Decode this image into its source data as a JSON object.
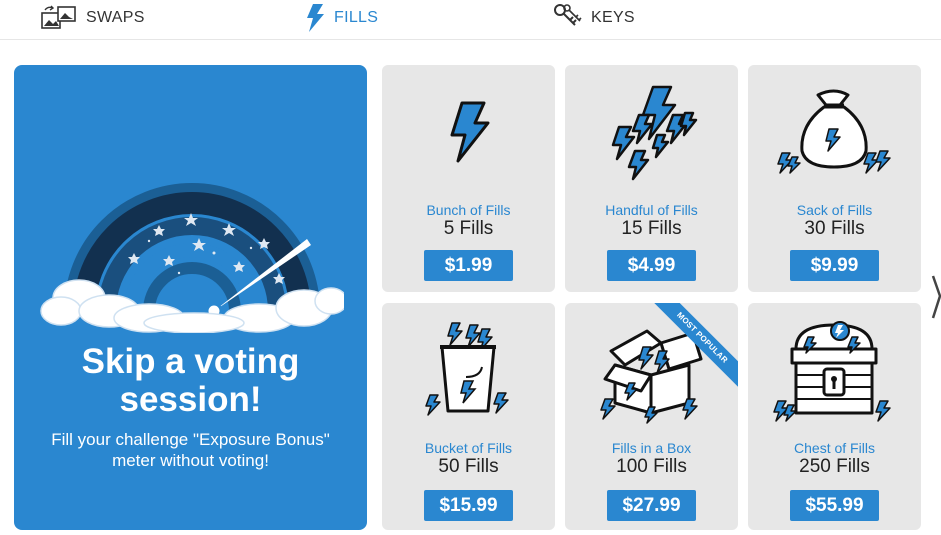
{
  "tabs": [
    {
      "label": "SWAPS",
      "icon": "swaps-icon",
      "active": false
    },
    {
      "label": "FILLS",
      "icon": "lightning-icon",
      "active": true
    },
    {
      "label": "KEYS",
      "icon": "keys-icon",
      "active": false
    }
  ],
  "promo": {
    "title_line1": "Skip a voting",
    "title_line2": "session!",
    "subtitle_line1": "Fill your challenge \"Exposure Bonus\"",
    "subtitle_line2": "meter without voting!"
  },
  "cards": [
    {
      "name": "Bunch of Fills",
      "qty": "5 Fills",
      "price": "$1.99",
      "icon": "single-bolt-icon"
    },
    {
      "name": "Handful of Fills",
      "qty": "15 Fills",
      "price": "$4.99",
      "icon": "many-bolts-icon"
    },
    {
      "name": "Sack of Fills",
      "qty": "30 Fills",
      "price": "$9.99",
      "icon": "sack-icon"
    },
    {
      "name": "Bucket of Fills",
      "qty": "50 Fills",
      "price": "$15.99",
      "icon": "bucket-icon"
    },
    {
      "name": "Fills in a Box",
      "qty": "100 Fills",
      "price": "$27.99",
      "icon": "box-icon",
      "ribbon": "MOST POPULAR"
    },
    {
      "name": "Chest of Fills",
      "qty": "250 Fills",
      "price": "$55.99",
      "icon": "chest-icon"
    }
  ],
  "colors": {
    "accent": "#2a87d0",
    "card_bg": "#e7e7e7",
    "dark": "#1a1a1a"
  }
}
